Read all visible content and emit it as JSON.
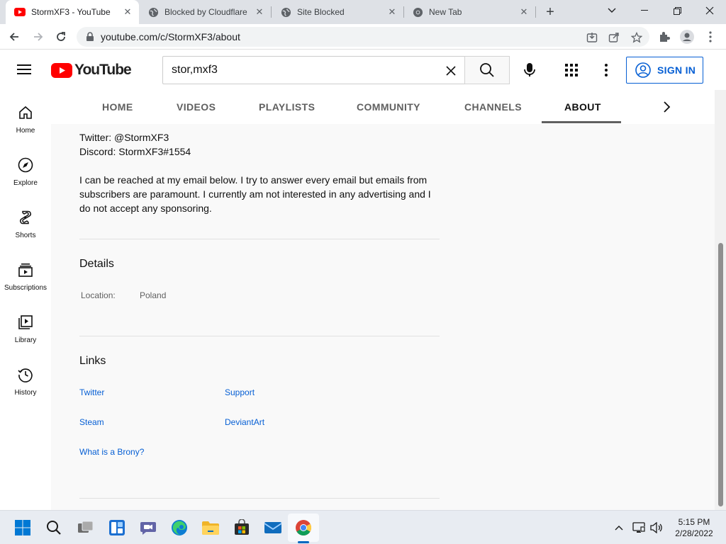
{
  "browser": {
    "tabs": [
      {
        "title": "StormXF3 - YouTube",
        "active": true
      },
      {
        "title": "Blocked by Cloudflare",
        "active": false
      },
      {
        "title": "Site Blocked",
        "active": false
      },
      {
        "title": "New Tab",
        "active": false
      }
    ],
    "url": "youtube.com/c/StormXF3/about",
    "new_tab_symbol": "+"
  },
  "youtube": {
    "logo_text": "YouTube",
    "search_query": "stor,mxf3",
    "sign_in_label": "SIGN IN",
    "guide": [
      {
        "label": "Home",
        "icon": "home-icon"
      },
      {
        "label": "Explore",
        "icon": "compass-icon"
      },
      {
        "label": "Shorts",
        "icon": "shorts-icon"
      },
      {
        "label": "Subscriptions",
        "icon": "subscriptions-icon"
      },
      {
        "label": "Library",
        "icon": "library-icon"
      },
      {
        "label": "History",
        "icon": "history-icon"
      }
    ],
    "channel_tabs": [
      "HOME",
      "VIDEOS",
      "PLAYLISTS",
      "COMMUNITY",
      "CHANNELS",
      "ABOUT"
    ],
    "active_tab": "ABOUT",
    "description_lines": [
      "Twitter: @StormXF3",
      "Discord: StormXF3#1554",
      "I can be reached at my email below. I try to answer every email but emails from",
      "subscribers are paramount. I currently am not interested in any advertising and I",
      "do not accept any sponsoring."
    ],
    "details": {
      "title": "Details",
      "location_label": "Location:",
      "location_value": "Poland"
    },
    "links": {
      "title": "Links",
      "items": [
        "Twitter",
        "Support",
        "Steam",
        "DeviantArt",
        "What is a Brony?"
      ]
    }
  },
  "taskbar": {
    "time": "5:15 PM",
    "date": "2/28/2022"
  },
  "colors": {
    "yt_red": "#ff0000",
    "link_blue": "#065fd4",
    "win_blue": "#0067c0"
  }
}
